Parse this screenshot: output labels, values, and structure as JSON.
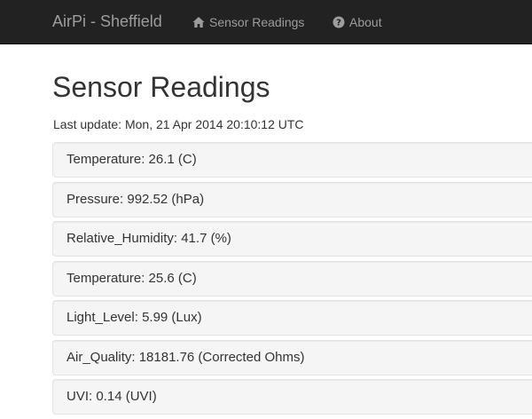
{
  "navbar": {
    "brand": "AirPi - Sheffield",
    "links": [
      {
        "label": "Sensor Readings",
        "icon": "home-icon"
      },
      {
        "label": "About",
        "icon": "question-circle-icon"
      }
    ],
    "colors": {
      "background": "#222222",
      "text": "#9d9d9d"
    }
  },
  "main": {
    "title": "Sensor Readings",
    "last_update_label": "Last update:",
    "last_update_value": "Mon, 21 Apr 2014 20:10:12 UTC",
    "readings": [
      {
        "text": "Temperature: 26.1 (C)"
      },
      {
        "text": "Pressure: 992.52 (hPa)"
      },
      {
        "text": "Relative_Humidity: 41.7 (%)"
      },
      {
        "text": "Temperature: 25.6 (C)"
      },
      {
        "text": "Light_Level: 5.99 (Lux)"
      },
      {
        "text": "Air_Quality: 18181.76 (Corrected Ohms)"
      },
      {
        "text": "UVI: 0.14 (UVI)"
      }
    ]
  }
}
